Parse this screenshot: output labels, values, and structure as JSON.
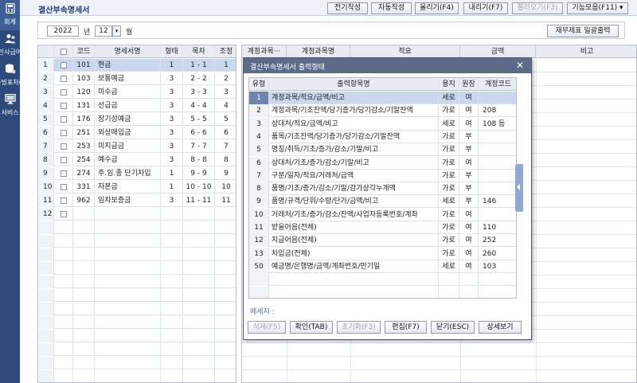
{
  "nav": {
    "items": [
      {
        "label": "회계",
        "icon": "calculator-icon"
      },
      {
        "label": "인사급여",
        "icon": "people-icon"
      },
      {
        "label": "증빙표처리",
        "icon": "database-icon"
      },
      {
        "label": "서비스",
        "icon": "monitor-icon"
      }
    ]
  },
  "window": {
    "title": "결산부속명세서"
  },
  "toolbar": {
    "buttons": [
      "전기작성",
      "자동작성",
      "올리기(F4)",
      "내리기(F7)",
      "불러오기(F3)",
      "기능모음(F11) ▾"
    ]
  },
  "filter": {
    "year": "2022",
    "year_suffix": "년",
    "month": "12",
    "month_dropdown": "▾",
    "month_suffix": "월",
    "report_button": "재무제표 일괄출력"
  },
  "left_table": {
    "headers": [
      "",
      "",
      "코드",
      "명세서명",
      "형태",
      "목차",
      "조정"
    ],
    "rows": [
      {
        "no": "1",
        "code": "101",
        "name": "현금",
        "type": "1",
        "toc": "1 - 1",
        "adj": "1"
      },
      {
        "no": "2",
        "code": "103",
        "name": "보통예금",
        "type": "3",
        "toc": "2 - 2",
        "adj": "2"
      },
      {
        "no": "3",
        "code": "120",
        "name": "미수금",
        "type": "3",
        "toc": "3 - 3",
        "adj": "3"
      },
      {
        "no": "4",
        "code": "131",
        "name": "선급금",
        "type": "3",
        "toc": "4 - 4",
        "adj": "4"
      },
      {
        "no": "5",
        "code": "176",
        "name": "장기성예금",
        "type": "3",
        "toc": "5 - 5",
        "adj": "5"
      },
      {
        "no": "6",
        "code": "251",
        "name": "외상매입금",
        "type": "3",
        "toc": "6 - 6",
        "adj": "6"
      },
      {
        "no": "7",
        "code": "253",
        "name": "미지급금",
        "type": "3",
        "toc": "7 - 7",
        "adj": "7"
      },
      {
        "no": "8",
        "code": "254",
        "name": "예수금",
        "type": "3",
        "toc": "8 - 8",
        "adj": "8"
      },
      {
        "no": "9",
        "code": "274",
        "name": "주.임.종 단기차입",
        "type": "1",
        "toc": "9 - 9",
        "adj": "9"
      },
      {
        "no": "10",
        "code": "331",
        "name": "자본금",
        "type": "1",
        "toc": "10 - 10",
        "adj": "10"
      },
      {
        "no": "11",
        "code": "962",
        "name": "임차보증금",
        "type": "3",
        "toc": "11 - 11",
        "adj": "11"
      },
      {
        "no": "12",
        "code": "",
        "name": "",
        "type": "",
        "toc": "",
        "adj": ""
      }
    ]
  },
  "right_table": {
    "headers": [
      "계정과목···",
      "계정과목명",
      "적요",
      "금액",
      "비고"
    ]
  },
  "modal": {
    "title": "결산부속명세서 출력형태",
    "close": "✕",
    "headers": [
      "유형",
      "출력항목명",
      "용지",
      "원장",
      "계정코드"
    ],
    "rows": [
      {
        "type": "1",
        "name": "계정과목/적요/금액/비고",
        "paper": "세로",
        "ledger": "여",
        "code": ""
      },
      {
        "type": "2",
        "name": "계정과목/기초잔액/당기증가/당기감소/기말잔액",
        "paper": "가로",
        "ledger": "여",
        "code": "208"
      },
      {
        "type": "3",
        "name": "상대처/적요/금액/비고",
        "paper": "세로",
        "ledger": "여",
        "code": "108 등"
      },
      {
        "type": "4",
        "name": "품목/기초잔액/당기증가/당기감소/기말잔액",
        "paper": "가로",
        "ledger": "부",
        "code": ""
      },
      {
        "type": "5",
        "name": "명칭/취득/기초/증가/감소/기말/비고",
        "paper": "가로",
        "ledger": "부",
        "code": ""
      },
      {
        "type": "6",
        "name": "상대처/기초/증가/감소/기말/비고",
        "paper": "가로",
        "ledger": "여",
        "code": ""
      },
      {
        "type": "7",
        "name": "구분/일자/적요/거래처/금액",
        "paper": "가로",
        "ledger": "부",
        "code": ""
      },
      {
        "type": "8",
        "name": "품명/기초/증가/감소/기말/감가상각누계액",
        "paper": "가로",
        "ledger": "부",
        "code": ""
      },
      {
        "type": "9",
        "name": "품명/규격/단위/수량/단가/금액/비고",
        "paper": "세로",
        "ledger": "부",
        "code": "146"
      },
      {
        "type": "10",
        "name": "거래처/기초/증가/감소/잔액/사업자등록번호/계좌",
        "paper": "가로",
        "ledger": "여",
        "code": ""
      },
      {
        "type": "11",
        "name": "받을어음(전체)",
        "paper": "가로",
        "ledger": "여",
        "code": "110"
      },
      {
        "type": "12",
        "name": "지급어음(전체)",
        "paper": "가로",
        "ledger": "여",
        "code": "252"
      },
      {
        "type": "13",
        "name": "차입금(전체)",
        "paper": "가로",
        "ledger": "여",
        "code": "260"
      },
      {
        "type": "50",
        "name": "예금명/은행명/금액/계좌번호/만기일",
        "paper": "세로",
        "ledger": "여",
        "code": "103"
      }
    ],
    "message_label": "메세지 :",
    "buttons": [
      "삭제(F5)",
      "확인(TAB)",
      "초기화(F3)",
      "편집(F7)",
      "닫기(ESC)",
      "상세보기"
    ]
  }
}
